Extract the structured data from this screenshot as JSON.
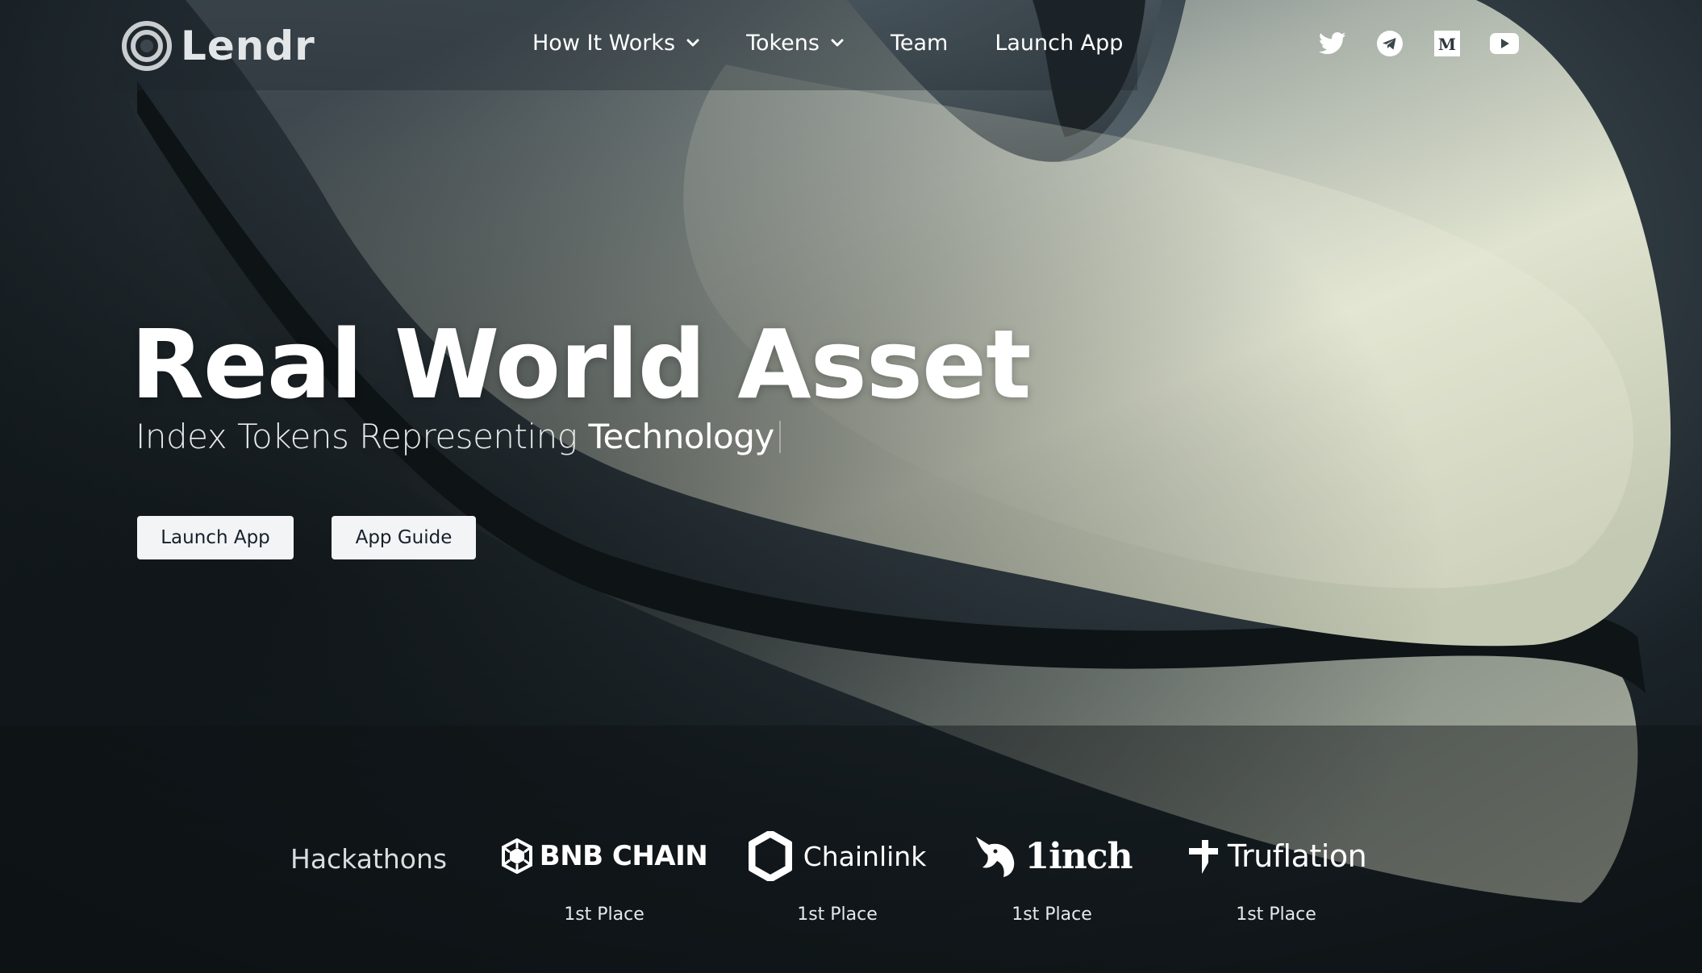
{
  "brand": {
    "name": "Lendr"
  },
  "nav": {
    "items": [
      {
        "label": "How It Works",
        "dropdown": true
      },
      {
        "label": "Tokens",
        "dropdown": true
      },
      {
        "label": "Team",
        "dropdown": false
      },
      {
        "label": "Launch App",
        "dropdown": false
      }
    ],
    "socials": [
      "twitter-icon",
      "telegram-icon",
      "medium-icon",
      "youtube-icon"
    ]
  },
  "hero": {
    "title": "Real World Asset",
    "subtitle_prefix": "Index Tokens Representing",
    "subtitle_highlight": "Technology",
    "buttons": {
      "launch": "Launch App",
      "guide": "App Guide"
    }
  },
  "hackathons": {
    "label": "Hackathons",
    "sponsors": [
      {
        "name": "BNB CHAIN",
        "place": "1st Place"
      },
      {
        "name": "Chainlink",
        "place": "1st Place"
      },
      {
        "name": "1inch",
        "place": "1st Place"
      },
      {
        "name": "Truflation",
        "place": "1st Place"
      }
    ]
  },
  "colors": {
    "background": "#141b20",
    "surface_highlight": "#e7ead6",
    "button_bg": "#f2f4f6",
    "button_text": "#17202a",
    "text": "#ffffff"
  }
}
